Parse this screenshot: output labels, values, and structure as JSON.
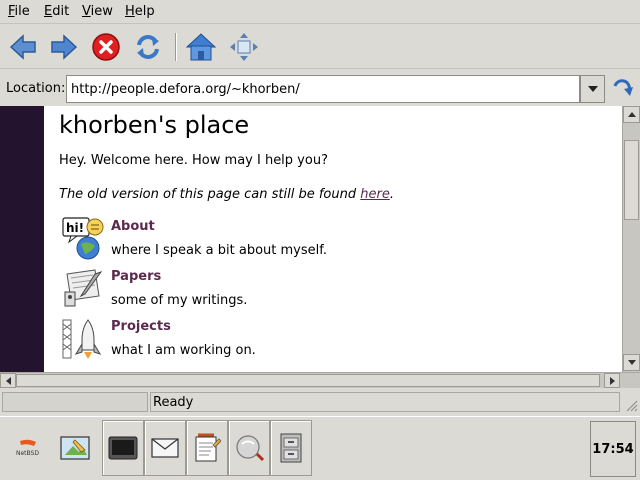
{
  "menubar": {
    "items": [
      {
        "key": "F",
        "rest": "ile"
      },
      {
        "key": "E",
        "rest": "dit"
      },
      {
        "key": "V",
        "rest": "iew"
      },
      {
        "key": "H",
        "rest": "elp"
      }
    ]
  },
  "toolbar": {
    "buttons": [
      "back-icon",
      "forward-icon",
      "stop-icon",
      "refresh-icon",
      "home-icon",
      "fullscreen-icon"
    ]
  },
  "location": {
    "label": "Location:",
    "url": "http://people.defora.org/~khorben/"
  },
  "page": {
    "title": "khorben's place",
    "welcome": "Hey. Welcome here. How may I help you?",
    "old_version_prefix": "The old version of this page can still be found ",
    "old_version_link": "here",
    "old_version_suffix": ".",
    "sections": [
      {
        "title": "About",
        "desc": "where I speak a bit about myself.",
        "icon": "hi-globe-icon"
      },
      {
        "title": "Papers",
        "desc": "some of my writings.",
        "icon": "papers-icon"
      },
      {
        "title": "Projects",
        "desc": "what I am working on.",
        "icon": "rocket-icon"
      }
    ],
    "link_color": "#5b2a4e"
  },
  "status": {
    "text": "Ready"
  },
  "taskbar": {
    "items": [
      "netbsd-logo-icon",
      "desktop-settings-icon",
      "terminal-icon",
      "mail-icon",
      "editor-icon",
      "search-icon",
      "file-manager-icon"
    ],
    "clock": "17:54"
  }
}
